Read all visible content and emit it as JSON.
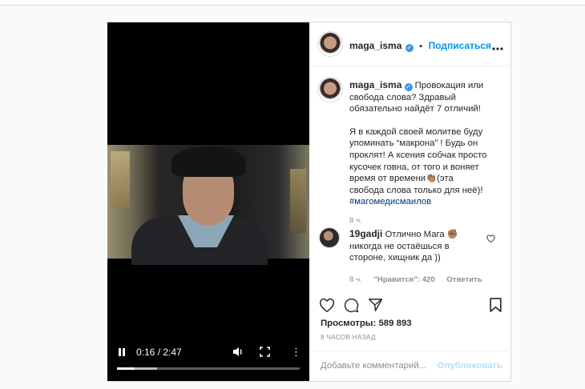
{
  "header": {
    "username": "maga_isma",
    "dot": "•",
    "follow_label": "Подписаться",
    "more_icon": "more-icon"
  },
  "video": {
    "current_time": "0:16",
    "duration": "2:47",
    "time_text": "0:16 / 2:47",
    "progress_fraction": 0.097,
    "icons": [
      "pause-icon",
      "volume-icon",
      "fullscreen-icon",
      "more-vertical-icon"
    ]
  },
  "caption": {
    "username": "maga_isma",
    "text1": "Провокация или свобода слова? Здравый обязательно найдёт 7 отличий!",
    "text2": "Я в каждой своей молитве буду упоминать “макрона” ! Будь он проклят! А ксения собчак просто кусочек говна, от того и воняет время от времени👏🏽(эта свобода слова только для неё)!",
    "hashtag": "#магомедисмаилов",
    "time": "8 ч."
  },
  "comment": {
    "username": "19gadji",
    "text": "Отлично Мага ✊🏽 никогда не остаёшься в стороне, хищник да ))",
    "time": "8 ч.",
    "likes": "\"Нравится\": 420",
    "reply": "Ответить"
  },
  "actions": {
    "icons": [
      "heart-icon",
      "comment-icon",
      "share-icon",
      "bookmark-icon"
    ],
    "views": "Просмотры: 589 893",
    "timestamp": "8 ЧАСОВ НАЗАД"
  },
  "add_comment": {
    "placeholder": "Добавьте комментарий...",
    "publish": "Опубликовать"
  },
  "colors": {
    "link": "#0095f6",
    "verified": "#3897f0",
    "publish_disabled": "#b2dffc",
    "muted": "#8e8e8e"
  }
}
